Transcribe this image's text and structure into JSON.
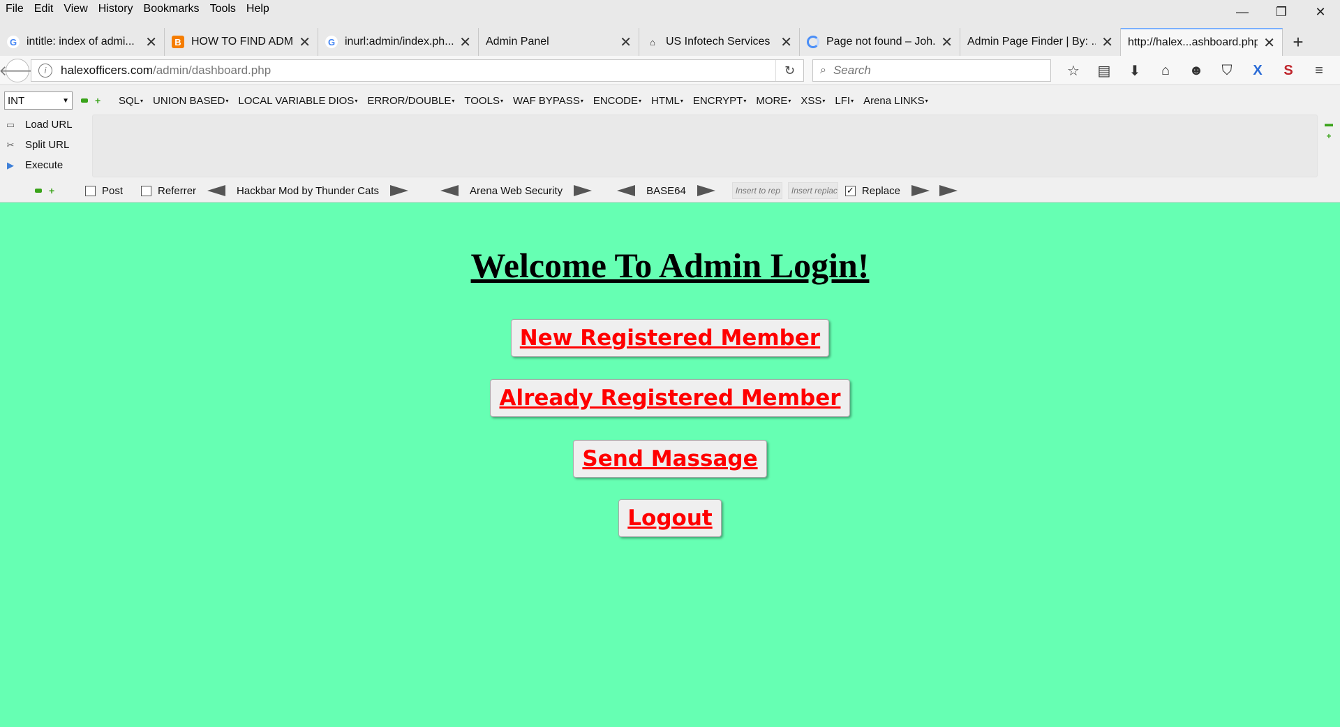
{
  "menubar": {
    "items": [
      "File",
      "Edit",
      "View",
      "History",
      "Bookmarks",
      "Tools",
      "Help"
    ]
  },
  "window_controls": {
    "minimize": "—",
    "restore": "❐",
    "close": "✕"
  },
  "tabs": [
    {
      "title": "intitle: index of admi...",
      "favicon": "google-icon"
    },
    {
      "title": "HOW TO FIND ADMI...",
      "favicon": "blogger-icon"
    },
    {
      "title": "inurl:admin/index.ph...",
      "favicon": "google-icon"
    },
    {
      "title": "Admin Panel",
      "favicon": "none"
    },
    {
      "title": "US Infotech Services",
      "favicon": "home-icon"
    },
    {
      "title": "Page not found – Joh...",
      "favicon": "loading-icon"
    },
    {
      "title": "Admin Page Finder | By: ...",
      "favicon": "none"
    },
    {
      "title": "http://halex...ashboard.php",
      "favicon": "none",
      "active": true
    }
  ],
  "nav": {
    "url_host": "halexofficers.com",
    "url_path": "/admin/dashboard.php",
    "search_placeholder": "Search"
  },
  "hackbar": {
    "select_value": "INT",
    "menu": [
      "SQL",
      "UNION BASED",
      "LOCAL VARIABLE DIOS",
      "ERROR/DOUBLE",
      "TOOLS",
      "WAF BYPASS",
      "ENCODE",
      "HTML",
      "ENCRYPT",
      "MORE",
      "XSS",
      "LFI",
      "Arena LINKS"
    ],
    "side": {
      "load_url": "Load URL",
      "split_url": "Split URL",
      "execute": "Execute"
    },
    "bottom": {
      "post_label": "Post",
      "referrer_label": "Referrer",
      "label1": "Hackbar Mod by Thunder Cats",
      "label2": "Arena Web Security",
      "label3": "BASE64",
      "insert_rep_placeholder": "Insert to rep",
      "insert_replace_placeholder": "Insert replac",
      "replace_label": "Replace"
    }
  },
  "page": {
    "heading": "Welcome To Admin Login!",
    "buttons": {
      "new_member": "New Registered Member",
      "already_member": "Already Registered Member",
      "send_message": "Send Massage",
      "logout": "Logout"
    },
    "colors": {
      "background": "#66ffb3",
      "link": "#ff0000"
    }
  }
}
